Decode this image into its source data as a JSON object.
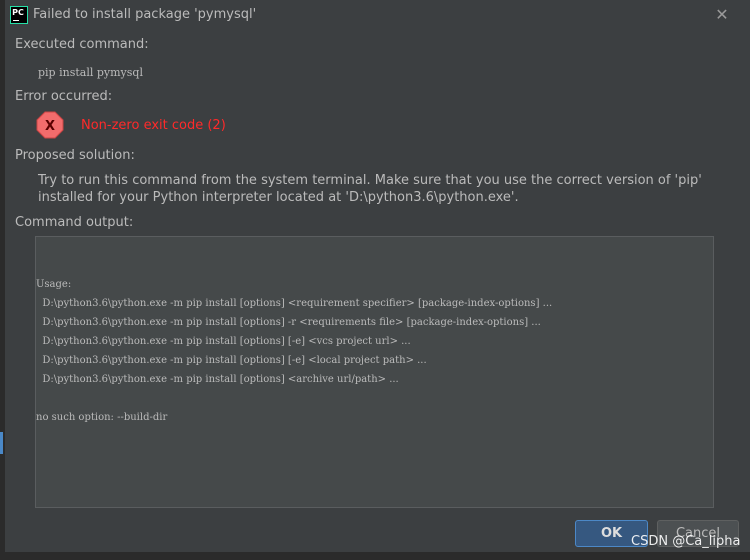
{
  "dialog": {
    "title": "Failed to install package 'pymysql'",
    "app_icon_name": "pycharm-icon",
    "close_icon": "close-icon"
  },
  "executed": {
    "label": "Executed command:",
    "command": "pip install pymysql"
  },
  "error": {
    "label": "Error occurred:",
    "icon": "error-icon",
    "icon_glyph": "X",
    "message": "Non-zero exit code (2)",
    "color": "#ff2a2a"
  },
  "solution": {
    "label": "Proposed solution:",
    "text": "Try to run this command from the system terminal. Make sure that you use the correct version of 'pip' installed for your Python interpreter located at 'D:\\python3.6\\python.exe'."
  },
  "output": {
    "label": "Command output:",
    "lines": [
      "Usage:",
      "  D:\\python3.6\\python.exe -m pip install [options] <requirement specifier> [package-index-options] ...",
      "  D:\\python3.6\\python.exe -m pip install [options] -r <requirements file> [package-index-options] ...",
      "  D:\\python3.6\\python.exe -m pip install [options] [-e] <vcs project url> ...",
      "  D:\\python3.6\\python.exe -m pip install [options] [-e] <local project path> ...",
      "  D:\\python3.6\\python.exe -m pip install [options] <archive url/path> ...",
      "no such option: --build-dir"
    ]
  },
  "buttons": {
    "ok": "OK",
    "cancel": "Cancel"
  },
  "watermark": "CSDN @Ca_lipha",
  "colors": {
    "background": "#3c3f41",
    "accent": "#365880",
    "error": "#ff2a2a"
  }
}
